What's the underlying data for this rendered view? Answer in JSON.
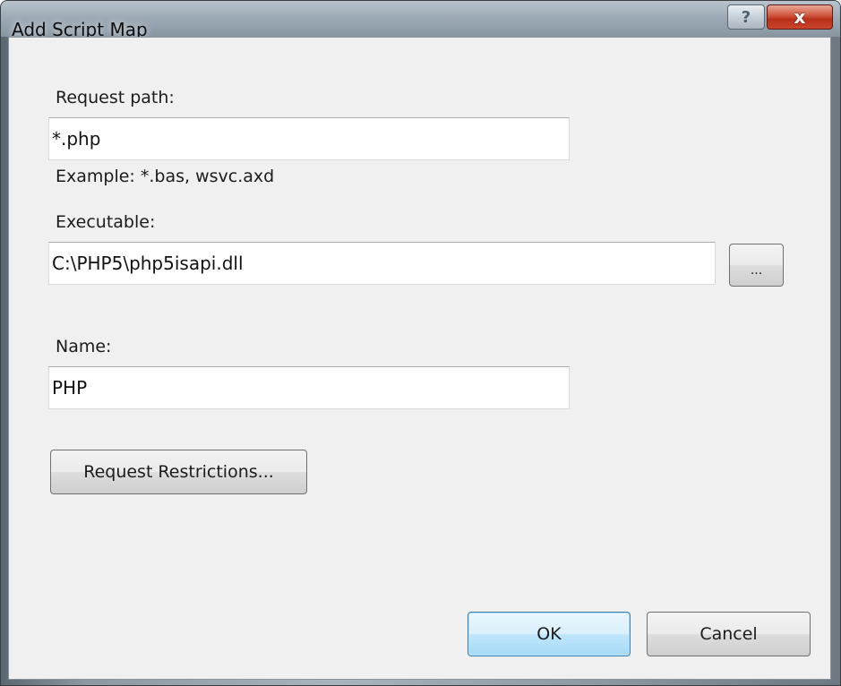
{
  "window": {
    "title": "Add Script Map",
    "help_glyph": "?",
    "close_glyph": "x"
  },
  "form": {
    "request_path_label": "Request path:",
    "request_path_value": "*.php",
    "example_text": "Example: *.bas, wsvc.axd",
    "executable_label": "Executable:",
    "executable_value": "C:\\PHP5\\php5isapi.dll",
    "browse_label": "...",
    "name_label": "Name:",
    "name_value": "PHP",
    "request_restrictions_label": "Request Restrictions..."
  },
  "footer": {
    "ok_label": "OK",
    "cancel_label": "Cancel"
  },
  "icons": {
    "help": "help-icon",
    "close": "close-icon"
  },
  "colors": {
    "client_bg": "#f0f0f0",
    "close_red": "#c9452b",
    "default_button_blue": "#3c7fb1"
  }
}
